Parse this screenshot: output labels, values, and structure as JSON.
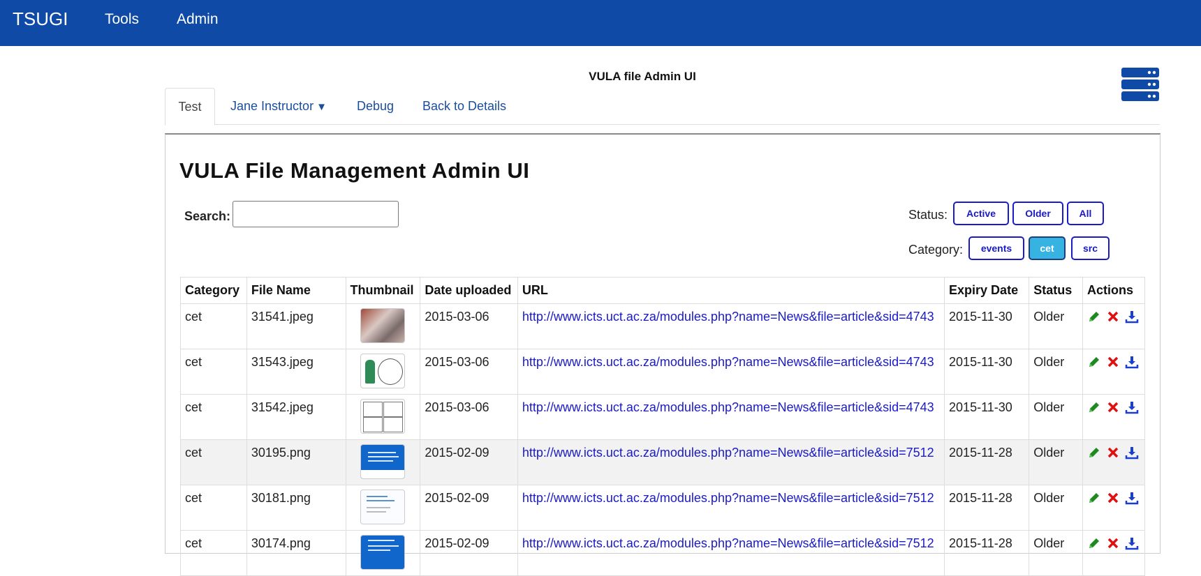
{
  "navbar": {
    "brand": "TSUGI",
    "tools": "Tools",
    "admin": "Admin"
  },
  "tool_title": "VULA file Admin UI",
  "tabs": [
    {
      "label": "Test"
    },
    {
      "label": "Jane Instructor",
      "caret": "▼"
    },
    {
      "label": "Debug"
    },
    {
      "label": "Back to Details"
    }
  ],
  "page_title": "VULA File Management Admin UI",
  "search": {
    "label": "Search:",
    "value": "",
    "placeholder": ""
  },
  "filters": {
    "status_label": "Status:",
    "status_options": [
      "Active",
      "Older",
      "All"
    ],
    "category_label": "Category:",
    "category_options": [
      "events",
      "cet",
      "src"
    ],
    "selected_category": "cet"
  },
  "table": {
    "headers": [
      "Category",
      "File Name",
      "Thumbnail",
      "Date uploaded",
      "URL",
      "Expiry Date",
      "Status",
      "Actions"
    ],
    "rows": [
      {
        "category": "cet",
        "file": "31541.jpeg",
        "thumb": "photo-thumbnail",
        "date": "2015-03-06",
        "url": "http://www.icts.uct.ac.za/modules.php?name=News&file=article&sid=4743",
        "expiry": "2015-11-30",
        "status": "Older"
      },
      {
        "category": "cet",
        "file": "31543.jpeg",
        "thumb": "hero-thumbnail",
        "date": "2015-03-06",
        "url": "http://www.icts.uct.ac.za/modules.php?name=News&file=article&sid=4743",
        "expiry": "2015-11-30",
        "status": "Older"
      },
      {
        "category": "cet",
        "file": "31542.jpeg",
        "thumb": "comic-thumbnail",
        "date": "2015-03-06",
        "url": "http://www.icts.uct.ac.za/modules.php?name=News&file=article&sid=4743",
        "expiry": "2015-11-30",
        "status": "Older"
      },
      {
        "category": "cet",
        "file": "30195.png",
        "thumb": "blue-poster-thumbnail",
        "date": "2015-02-09",
        "url": "http://www.icts.uct.ac.za/modules.php?name=News&file=article&sid=7512",
        "expiry": "2015-11-28",
        "status": "Older"
      },
      {
        "category": "cet",
        "file": "30181.png",
        "thumb": "light-poster-thumbnail",
        "date": "2015-02-09",
        "url": "http://www.icts.uct.ac.za/modules.php?name=News&file=article&sid=7512",
        "expiry": "2015-11-28",
        "status": "Older"
      },
      {
        "category": "cet",
        "file": "30174.png",
        "thumb": "blue-poster-thumbnail",
        "date": "2015-02-09",
        "url": "http://www.icts.uct.ac.za/modules.php?name=News&file=article&sid=7512",
        "expiry": "2015-11-28",
        "status": "Older"
      }
    ]
  },
  "icons": {
    "edit": "pencil-icon",
    "delete": "cross-icon",
    "download": "download-icon",
    "server": "server-stack-icon"
  },
  "colors": {
    "navbar": "#0f4aa6",
    "link": "#1a1ac8",
    "selected_filter": "#36b3e0",
    "edit": "#1e8a1e",
    "delete": "#e01010",
    "download": "#1a3fd0"
  }
}
